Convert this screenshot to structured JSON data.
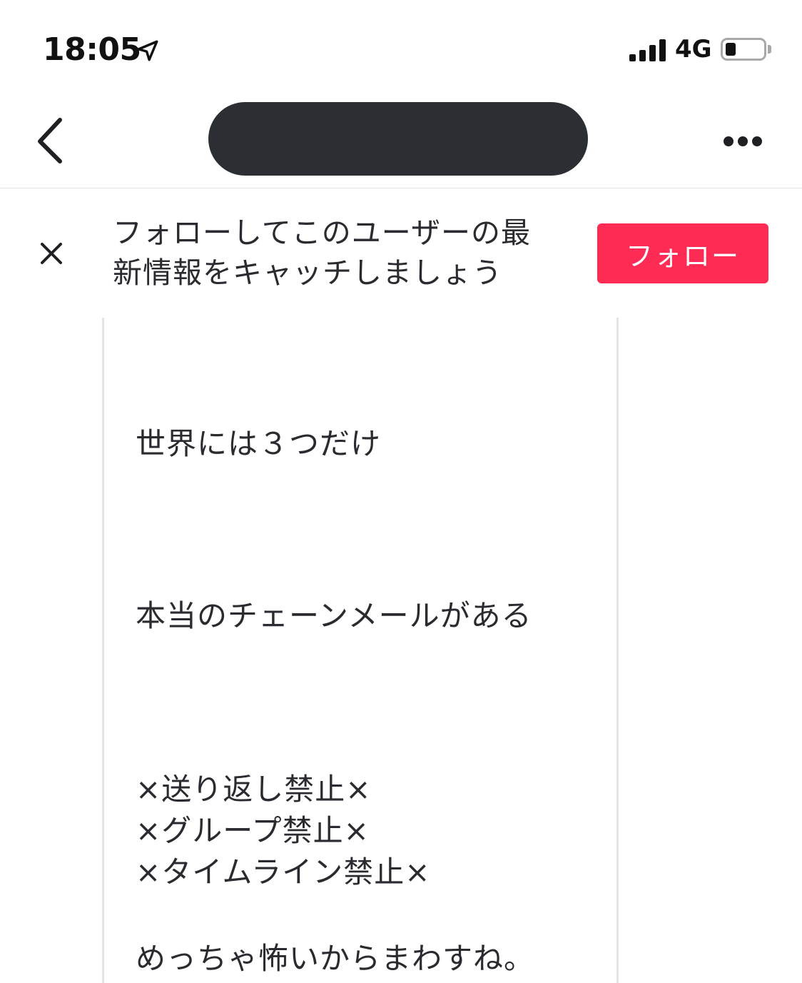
{
  "status_bar": {
    "time": "18:05",
    "network": "4G",
    "icons": [
      "location-arrow-icon",
      "signal-bars-icon",
      "battery-icon"
    ]
  },
  "nav": {
    "back_icon": "chevron-left-icon",
    "more_icon": "more-dots-icon"
  },
  "follow_banner": {
    "close_icon": "close-icon",
    "message_line1": "フォローしてこのユーザーの最",
    "message_line2": "新情報をキャッチしましょう",
    "button_label": "フォロー",
    "button_color": "#fe2c55"
  },
  "note": {
    "lines": [
      "世界には３つだけ",
      "本当のチェーンメールがある",
      "×送り返し禁止×",
      "×グループ禁止×",
      "×タイムライン禁止×",
      "めっちゃ怖いからまわすね。"
    ]
  }
}
